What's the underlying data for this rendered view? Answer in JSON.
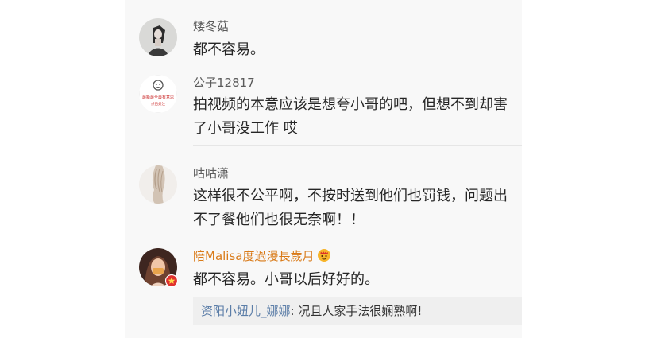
{
  "comments": [
    {
      "username": "矮冬菇",
      "text": "都不容易。"
    },
    {
      "username": "公子12817",
      "text": "拍视频的本意应该是想夸小哥的吧，但想不到却害了小哥没工作 哎",
      "avatar_lines": [
        "最新最全最有意思",
        "点击关注"
      ]
    },
    {
      "username": "咕咕潇",
      "text": "这样很不公平啊，不按时送到他们也罚钱，问题出不了餐他们也很无奈啊！！"
    },
    {
      "username": "陪Malisa度過漫長歲月",
      "text": "都不容易。小哥以后好好的。",
      "reply": {
        "user": "资阳小妞儿_娜娜",
        "text": "况且人家手法很娴熟啊!"
      }
    }
  ],
  "colors": {
    "username": "#5b5b5b",
    "vip_username": "#d97a18",
    "reply_user": "#5c7ea8",
    "text": "#262626",
    "panel_bg": "#f8f8f8",
    "reply_bg": "#efefef"
  }
}
